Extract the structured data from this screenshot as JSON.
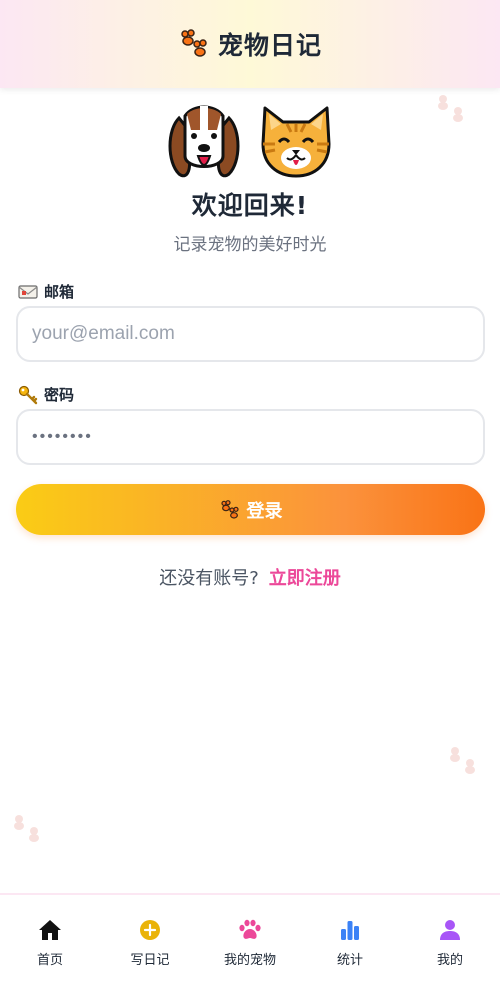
{
  "header": {
    "title": "宠物日记",
    "icon": "paw-icon"
  },
  "hero": {
    "icons": [
      "dog-icon",
      "cat-icon"
    ],
    "welcome": "欢迎回来!",
    "subtitle": "记录宠物的美好时光"
  },
  "form": {
    "email_label": "邮箱",
    "email_placeholder": "your@email.com",
    "password_label": "密码",
    "password_value": "12345678",
    "login_label": "登录"
  },
  "register": {
    "prompt": "还没有账号?",
    "link": "立即注册"
  },
  "nav": {
    "items": [
      {
        "label": "首页",
        "icon": "home-icon"
      },
      {
        "label": "写日记",
        "icon": "add-circle-icon"
      },
      {
        "label": "我的宠物",
        "icon": "paw-icon"
      },
      {
        "label": "统计",
        "icon": "bar-chart-icon"
      },
      {
        "label": "我的",
        "icon": "user-icon"
      }
    ]
  },
  "colors": {
    "accent_pink": "#ec4899",
    "button_start": "#facc15",
    "button_end": "#f97316",
    "paw_orange": "#f97316"
  }
}
